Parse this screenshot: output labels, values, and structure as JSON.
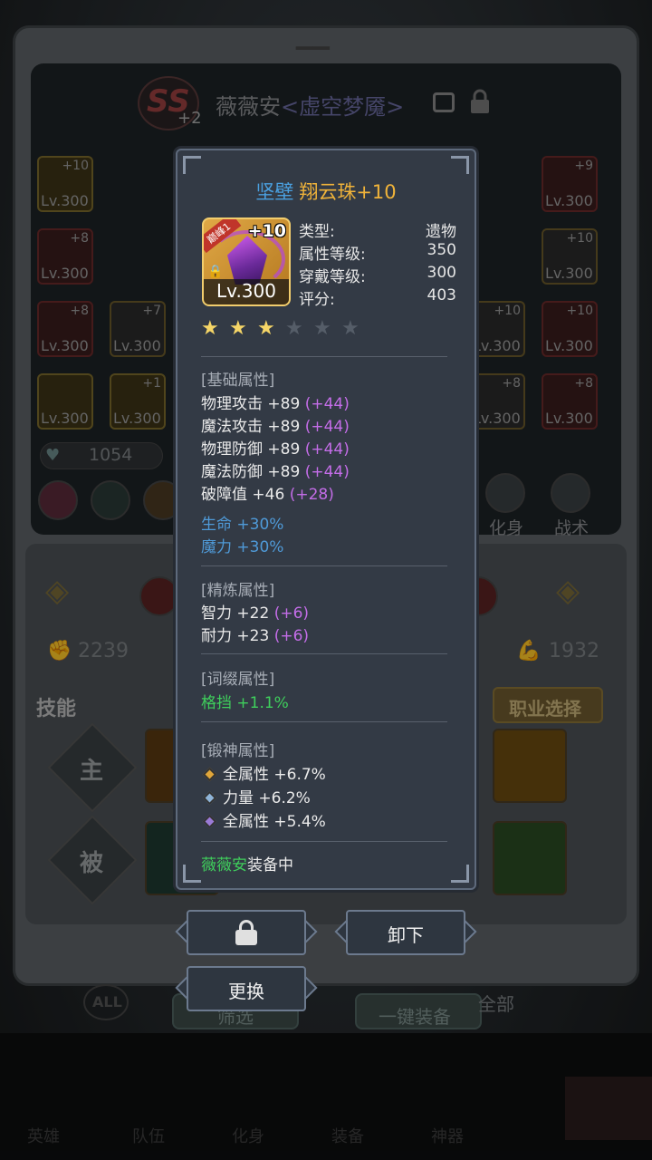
{
  "background": {
    "character": {
      "rank": "SS",
      "rank_plus": "+2",
      "name": "薇薇安",
      "title": "<虚空梦魇>"
    },
    "equipment_slots": [
      {
        "lv": "Lv.300",
        "plus": "+10"
      },
      {
        "lv": "Lv.300",
        "plus": "+8"
      },
      {
        "lv": "Lv.300",
        "plus": "+8"
      },
      {
        "lv": "Lv.300",
        "plus": "+7"
      },
      {
        "lv": "Lv.300",
        "plus": ""
      },
      {
        "lv": "Lv.300",
        "plus": "+1"
      },
      {
        "lv": "Lv.300",
        "plus": "+9"
      },
      {
        "lv": "Lv.300",
        "plus": "+10"
      },
      {
        "lv": "Lv.300",
        "plus": "+10"
      },
      {
        "lv": "Lv.300",
        "plus": "+10"
      },
      {
        "lv": "Lv.300",
        "plus": "+8"
      },
      {
        "lv": "Lv.300",
        "plus": "+8"
      },
      {
        "lv": "Lv.300",
        "plus": "+10"
      }
    ],
    "score": "1054",
    "side_buttons": {
      "avatar": "化身",
      "tactics": "战术"
    },
    "stat_left": "2239",
    "stat_right": "1932",
    "skills_label": "技能",
    "job_select": "职业选择",
    "skill_rows": {
      "active": "主",
      "passive": "被"
    },
    "bottom_buttons": {
      "all": "ALL",
      "filter": "筛选",
      "one_click": "一键装备",
      "all_tab": "全部"
    },
    "nav": [
      "英雄",
      "队伍",
      "化身",
      "装备",
      "神器"
    ]
  },
  "tooltip": {
    "quality": "坚壁",
    "item_name": "翔云珠+10",
    "icon": {
      "plus": "+10",
      "level": "Lv.300",
      "peak_tag": "巅峰1",
      "name": "spirit-orb-icon"
    },
    "info": [
      {
        "label": "类型:",
        "value": "遗物"
      },
      {
        "label": "属性等级:",
        "value": "350"
      },
      {
        "label": "穿戴等级:",
        "value": "300"
      },
      {
        "label": "评分:",
        "value": "403"
      }
    ],
    "stars_total": 6,
    "stars_filled": 3,
    "base_label": "[基础属性]",
    "base_attrs": [
      {
        "text": "物理攻击 +89",
        "bonus": "(+44)"
      },
      {
        "text": "魔法攻击 +89",
        "bonus": "(+44)"
      },
      {
        "text": "物理防御 +89",
        "bonus": "(+44)"
      },
      {
        "text": "魔法防御 +89",
        "bonus": "(+44)"
      },
      {
        "text": "破障值 +46",
        "bonus": "(+28)"
      }
    ],
    "special_attrs": [
      "生命 +30%",
      "魔力 +30%"
    ],
    "refine_label": "[精炼属性]",
    "refine_attrs": [
      {
        "text": "智力 +22",
        "bonus": "(+6)"
      },
      {
        "text": "耐力 +23",
        "bonus": "(+6)"
      }
    ],
    "affix_label": "[词缀属性]",
    "affix_attrs": [
      "格挡 +1.1%"
    ],
    "forge_label": "[锻神属性]",
    "forge_attrs": [
      {
        "text": "全属性 +6.7%",
        "color": "#e0a63a"
      },
      {
        "text": "力量 +6.2%",
        "color": "#8fb4d8"
      },
      {
        "text": "全属性 +5.4%",
        "color": "#9a7ad6"
      }
    ],
    "equipped_by": "薇薇安",
    "equipped_suffix": "装备中"
  },
  "actions": {
    "unequip": "卸下",
    "replace": "更换"
  },
  "colors": {
    "quality_blue": "#4aa0e0",
    "item_gold": "#f0b33a",
    "bonus_purple": "#c46de8",
    "special_blue": "#4f9ad8",
    "affix_green": "#3fcf5c"
  }
}
